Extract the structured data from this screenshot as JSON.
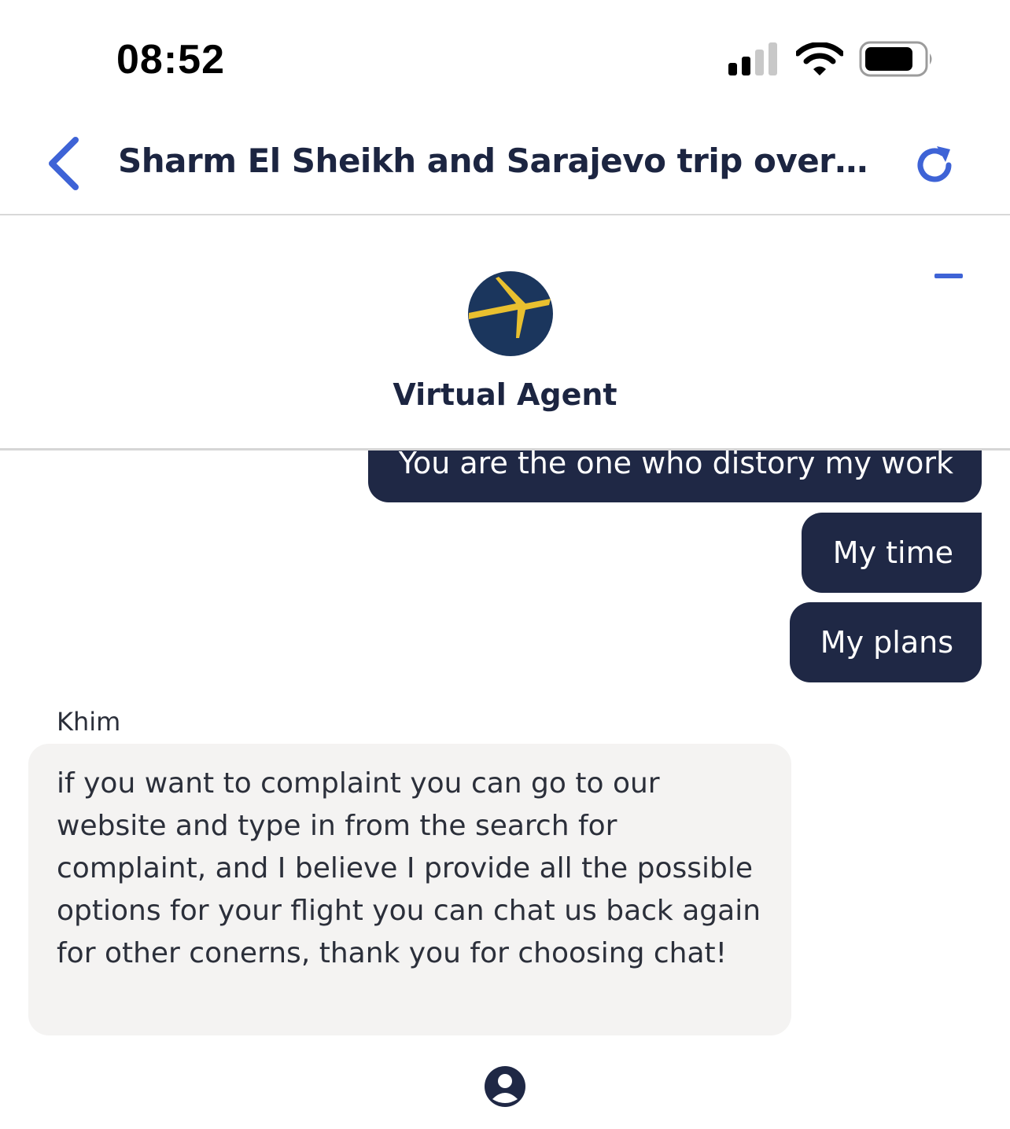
{
  "status_bar": {
    "time": "08:52",
    "icons": [
      "cellular-signal-icon",
      "wifi-icon",
      "battery-icon"
    ]
  },
  "header": {
    "back_icon": "chevron-left-icon",
    "title": "Sharm El Sheikh and Sarajevo trip overvie...",
    "refresh_icon": "refresh-icon"
  },
  "agent_panel": {
    "minimize_icon": "minus-icon",
    "logo_icon": "expedia-plane-logo",
    "name": "Virtual Agent"
  },
  "chat": {
    "user_messages": [
      "You are the one who distory my work",
      "My time",
      "My plans"
    ],
    "agent_message": {
      "sender": "Khim",
      "text": "if you want to complaint you can go to our website and type in from the search for complaint, and I believe I provide all the possible options for your flight you can chat us back again for other conerns, thank you for choosing chat!"
    },
    "next_sender_icon": "user-avatar-icon"
  },
  "colors": {
    "accent": "#3e63d6",
    "user_bubble": "#1f2845",
    "agent_bubble": "#f4f3f2",
    "logo_navy": "#1b365d",
    "logo_yellow": "#e9c02f"
  }
}
